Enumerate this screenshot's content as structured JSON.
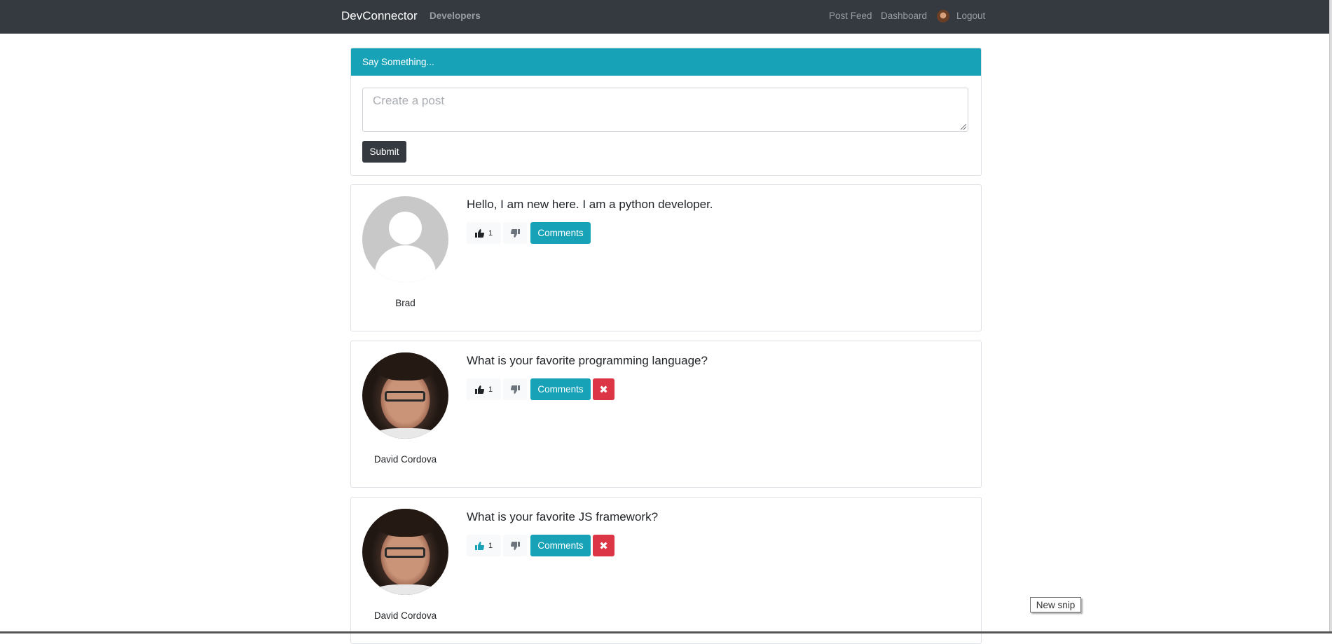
{
  "navbar": {
    "brand": "DevConnector",
    "developers": "Developers",
    "post_feed": "Post Feed",
    "dashboard": "Dashboard",
    "logout": "Logout"
  },
  "post_form": {
    "header": "Say Something...",
    "placeholder": "Create a post",
    "submit_label": "Submit"
  },
  "posts": [
    {
      "text": "Hello, I am new here. I am a python developer.",
      "author": "Brad",
      "likes": "1",
      "comments_label": "Comments",
      "liked": false,
      "avatar": "default-user-icon"
    },
    {
      "text": "What is your favorite programming language?",
      "author": "David Cordova",
      "likes": "1",
      "comments_label": "Comments",
      "delete_label": "✖",
      "liked": false,
      "avatar": "user-photo"
    },
    {
      "text": "What is your favorite JS framework?",
      "author": "David Cordova",
      "likes": "1",
      "comments_label": "Comments",
      "delete_label": "✖",
      "liked": true,
      "avatar": "user-photo"
    }
  ],
  "snip_tooltip": "New snip",
  "colors": {
    "navbar": "#343a40",
    "info": "#17a2b8",
    "danger": "#dc3545",
    "liked_icon": "#17a2b8"
  }
}
